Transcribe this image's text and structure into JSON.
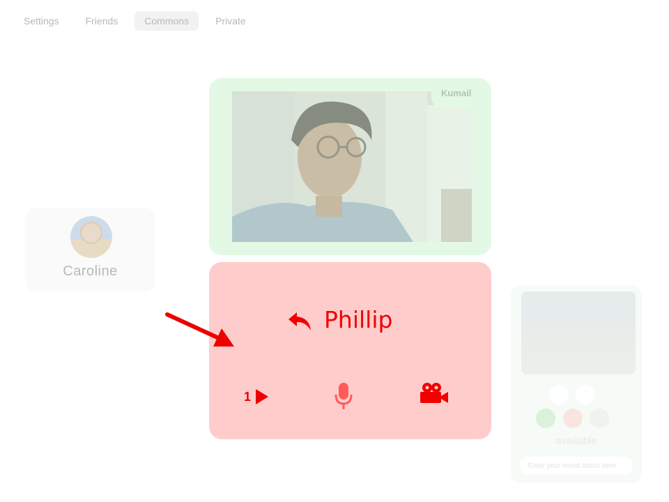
{
  "nav": {
    "tabs": [
      {
        "label": "Settings"
      },
      {
        "label": "Friends"
      },
      {
        "label": "Commons",
        "active": true
      },
      {
        "label": "Private"
      }
    ]
  },
  "people": {
    "caroline": {
      "name": "Caroline"
    }
  },
  "video_call": {
    "participant_name": "Kumail"
  },
  "incoming_call": {
    "caller_name": "Phillip",
    "play_count": "1",
    "icons": [
      "reply-icon",
      "play-icon",
      "microphone-icon",
      "video-camera-icon"
    ]
  },
  "side_panel": {
    "status": "available",
    "mood_placeholder": "Enter your mood status here"
  },
  "colors": {
    "call_red": "#f20000",
    "call_card_bg": "#ffcccc",
    "video_card_bg": "#e3f9e5",
    "arrow": "#ee0000"
  }
}
